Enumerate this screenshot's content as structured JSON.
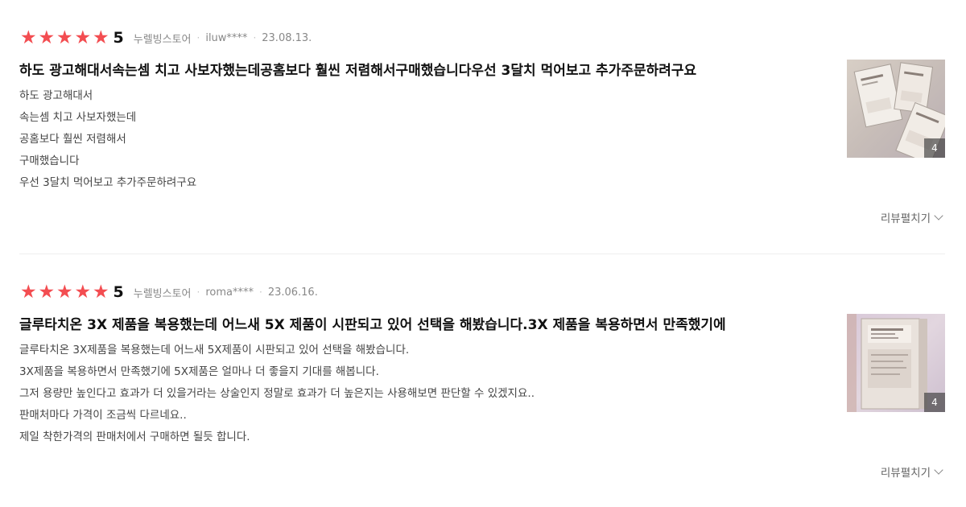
{
  "colors": {
    "star": "#f34d51",
    "expand_text": "#666666"
  },
  "reviews": [
    {
      "rating": "5",
      "store": "누렐빙스토어",
      "user": "iluw****",
      "date": "23.08.13.",
      "title": "하도 광고해대서속는셈 치고 사보자했는데공홈보다 훨씬 저렴해서구매했습니다우선 3달치 먹어보고 추가주문하려구요",
      "lines": [
        "하도 광고해대서",
        "속는셈 치고 사보자했는데",
        "공홈보다 훨씬 저렴해서",
        "구매했습니다",
        "우선 3달치 먹어보고 추가주문하려구요"
      ],
      "photo_count": "4",
      "expand_label": "리뷰펼치기",
      "expand_icon": "chevron-down-icon"
    },
    {
      "rating": "5",
      "store": "누렐빙스토어",
      "user": "roma****",
      "date": "23.06.16.",
      "title": "글루타치온 3X 제품을 복용했는데 어느새 5X 제품이 시판되고 있어 선택을 해봤습니다.3X 제품을 복용하면서 만족했기에",
      "lines": [
        "글루타치온 3X제품을 복용했는데 어느새 5X제품이 시판되고 있어 선택을 해봤습니다.",
        "3X제품을 복용하면서 만족했기에 5X제품은 얼마나 더 좋을지 기대를 해봅니다.",
        "그저 용량만 높인다고 효과가 더 있을거라는 상술인지 정말로 효과가 더 높은지는 사용해보면 판단할 수 있겠지요..",
        "판매처마다 가격이 조금씩 다르네요..",
        "제일 착한가격의 판매처에서 구매하면 될듯 합니다."
      ],
      "photo_count": "4",
      "expand_label": "리뷰펼치기",
      "expand_icon": "chevron-down-icon"
    }
  ]
}
